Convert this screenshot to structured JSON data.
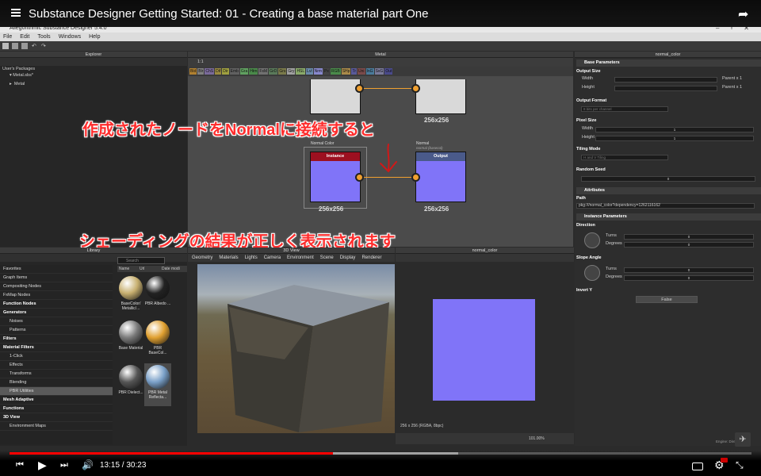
{
  "video": {
    "title": "Substance Designer Getting Started: 01 - Creating a base material part One",
    "time_current": "13:15",
    "time_total": "30:23",
    "progress": 0.436,
    "buffered": 0.605
  },
  "app": {
    "title": "Allegorithmic Substance Designer 5.4.0",
    "menu": [
      "File",
      "Edit",
      "Tools",
      "Windows",
      "Help"
    ]
  },
  "explorer": {
    "header": "Explorer",
    "root": "User's Packages",
    "package": "Metal.sbs*",
    "graph": "Metal"
  },
  "graph": {
    "header": "Metal",
    "zoom": "1:1",
    "chips": [
      "Bld",
      "Blr",
      "ChS",
      "Dif",
      "Dir",
      "Emb",
      "Gra",
      "Htm",
      "FxM",
      "GrD",
      "Grs",
      "Gry",
      "HSL",
      "Lvl",
      "Nrm",
      "Px",
      "RGB",
      "SHp",
      "Tr",
      "Uni",
      "InG",
      "SvG",
      "Out"
    ],
    "node_normal_color": {
      "title": "Normal Color",
      "sub": "",
      "head": "Instance",
      "res": "256x256"
    },
    "node_output": {
      "title": "Normal",
      "sub": "normal (basecol)",
      "head": "Output",
      "res": "256x256"
    },
    "top_res": "256x256"
  },
  "subtitles": {
    "line1": "作成されたノードをNormalに接続すると",
    "line2": "シェーディングの結果が正しく表示されます"
  },
  "library": {
    "header": "Library",
    "search_placeholder": "Search",
    "columns": [
      "Name",
      "Url",
      "Date modi"
    ],
    "rows": [
      {
        "label": "Favorites",
        "kind": "item"
      },
      {
        "label": "Graph Items",
        "kind": "item"
      },
      {
        "label": "Compositing Nodes",
        "kind": "item"
      },
      {
        "label": "FxMap Nodes",
        "kind": "item"
      },
      {
        "label": "Function Nodes",
        "kind": "section"
      },
      {
        "label": "Generators",
        "kind": "section"
      },
      {
        "label": "Noises",
        "kind": "sub"
      },
      {
        "label": "Patterns",
        "kind": "sub"
      },
      {
        "label": "Filters",
        "kind": "section"
      },
      {
        "label": "Material Filters",
        "kind": "section"
      },
      {
        "label": "1-Click",
        "kind": "sub"
      },
      {
        "label": "Effects",
        "kind": "sub"
      },
      {
        "label": "Transforms",
        "kind": "sub"
      },
      {
        "label": "Blending",
        "kind": "sub"
      },
      {
        "label": "PBR Utilities",
        "kind": "selected"
      },
      {
        "label": "Mesh Adaptive",
        "kind": "section"
      },
      {
        "label": "Functions",
        "kind": "section"
      },
      {
        "label": "3D View",
        "kind": "section"
      },
      {
        "label": "Environment Maps",
        "kind": "sub"
      }
    ],
    "thumbs": [
      {
        "label": "BaseColor/ Metallic/...",
        "color": "#c8b070"
      },
      {
        "label": "PBR Albedo ...",
        "color": "#222222"
      },
      {
        "label": "Base Material",
        "color": "#7a7a7a"
      },
      {
        "label": "PBR BaseCol...",
        "color": "#e0a030"
      },
      {
        "label": "PBR Dielect...",
        "color": "#555555"
      },
      {
        "label": "PBR Metal Reflecta...",
        "color": "#7aa0c8"
      }
    ]
  },
  "view3d": {
    "header": "3D View",
    "menu": [
      "Geometry",
      "Materials",
      "Lights",
      "Camera",
      "Environment",
      "Scene",
      "Display",
      "Renderer"
    ]
  },
  "view2d": {
    "header": "normal_color",
    "info": "256 x 256 (RGBA, 8bpc)",
    "zoom": "101.00%",
    "swatch": "#8074f8"
  },
  "props": {
    "header": "normal_color",
    "base_params": "Base Parameters",
    "output_size": "Output Size",
    "width": "Width",
    "height": "Height",
    "parent_w": "Parent x 1",
    "parent_h": "Parent x 1",
    "output_format": "Output Format",
    "output_format_val": "8 bits per channel",
    "pixel_size": "Pixel Size",
    "px_w_val": "1",
    "px_h_val": "1",
    "tiling_mode": "Tiling Mode",
    "tiling_val": "H and V Tiling",
    "random_seed": "Random Seed",
    "seed_val": "0",
    "attributes": "Attributes",
    "path_label": "Path",
    "path_val": "pkg:///normal_color?dependency=1262116162",
    "instance_params": "Instance Parameters",
    "direction": "Direction",
    "turns": "Turns",
    "degrees": "Degrees",
    "zero": "0",
    "slope_angle": "Slope Angle",
    "invert_y": "Invert Y",
    "false_val": "False",
    "status": "Engine: Direct3D 10"
  },
  "colors": {
    "progress_red": "#ff0000",
    "normal_purple": "#8074f8",
    "connector_orange": "#f0a030",
    "instance_red": "#9c1020",
    "output_blue": "#4a5a8a"
  }
}
